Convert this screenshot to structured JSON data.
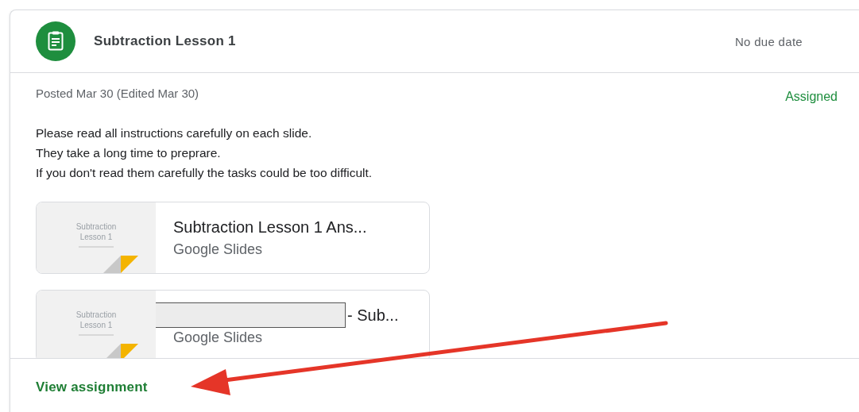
{
  "assignment": {
    "title": "Subtraction Lesson 1",
    "due": "No due date",
    "posted": "Posted Mar 30 (Edited Mar 30)",
    "status": "Assigned",
    "instructions": [
      "Please read all instructions carefully on each slide.",
      "They take a long time to preprare.",
      "If you don't read them carefully the tasks could be too difficult."
    ],
    "attachments": [
      {
        "thumbnail_lines": [
          "Subtraction",
          "Lesson 1"
        ],
        "title": "Subtraction Lesson 1 Ans...",
        "redacted": false,
        "type": "Google Slides"
      },
      {
        "thumbnail_lines": [
          "Subtraction",
          "Lesson 1"
        ],
        "title": "- Sub...",
        "redacted": true,
        "type": "Google Slides"
      }
    ],
    "link": "View assignment"
  }
}
